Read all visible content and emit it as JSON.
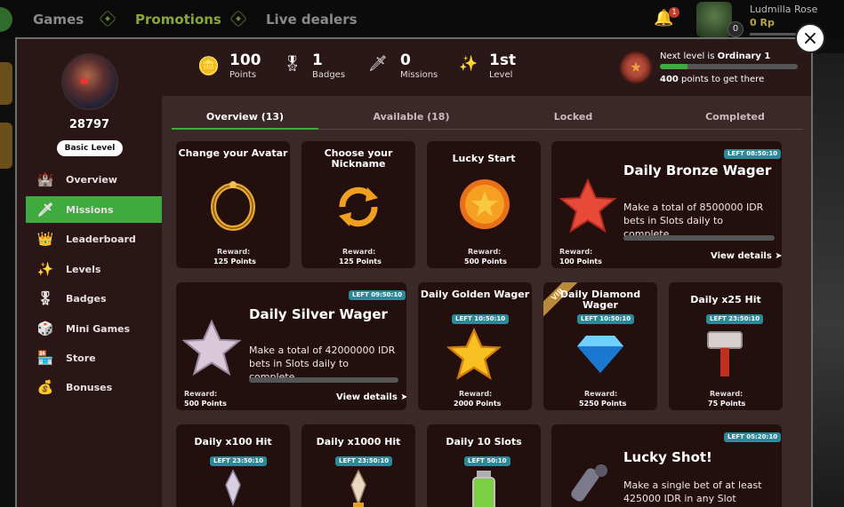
{
  "nav": {
    "games": "Games",
    "promotions": "Promotions",
    "live_dealers": "Live dealers",
    "bell_count": "1",
    "user_name": "Ludmilla Rose",
    "user_balance": "0 Rp",
    "avatar_level": "0"
  },
  "close_label": "×",
  "sidebar": {
    "user_id": "28797",
    "level_badge": "Basic Level",
    "items": [
      {
        "label": "Overview",
        "icon": "castle-icon"
      },
      {
        "label": "Missions",
        "icon": "sword-icon"
      },
      {
        "label": "Leaderboard",
        "icon": "crown-icon"
      },
      {
        "label": "Levels",
        "icon": "sparkles-icon"
      },
      {
        "label": "Badges",
        "icon": "medal-icon"
      },
      {
        "label": "Mini Games",
        "icon": "dice-icon"
      },
      {
        "label": "Store",
        "icon": "shop-icon"
      },
      {
        "label": "Bonuses",
        "icon": "money-bag-icon"
      }
    ]
  },
  "stats": {
    "points_value": "100",
    "points_label": "Points",
    "badges_value": "1",
    "badges_label": "Badges",
    "missions_value": "0",
    "missions_label": "Missions",
    "level_value": "1st",
    "level_label": "Level"
  },
  "next_level": {
    "prefix": "Next level is ",
    "name": "Ordinary 1",
    "progress": 0.2,
    "points": "400",
    "suffix": " points to get there"
  },
  "tabs": [
    "Overview (13)",
    "Available (18)",
    "Locked",
    "Completed"
  ],
  "reward_label": "Reward:",
  "view_details": "View details",
  "cards": {
    "avatar": {
      "title": "Change your Avatar",
      "reward": "125 Points"
    },
    "nickname": {
      "title": "Choose your Nickname",
      "reward": "125 Points"
    },
    "lucky_start": {
      "title": "Lucky Start",
      "reward": "500 Points"
    },
    "bronze": {
      "title": "Daily Bronze Wager",
      "timer": "LEFT 08:50:10",
      "desc": "Make a total of 8500000 IDR bets in Slots daily to complete…",
      "reward": "100 Points"
    },
    "silver": {
      "title": "Daily Silver Wager",
      "timer": "LEFT 09:50:10",
      "desc": "Make a total of 42000000 IDR bets in Slots daily to complete…",
      "reward": "500 Points"
    },
    "golden": {
      "title": "Daily Golden Wager",
      "timer": "LEFT 10:50:10",
      "reward": "2000 Points"
    },
    "diamond": {
      "title": "Daily Diamond Wager",
      "timer": "LEFT 10:50:10",
      "vip": "VIP",
      "reward": "5250 Points"
    },
    "x25": {
      "title": "Daily x25 Hit",
      "timer": "LEFT 23:50:10",
      "reward": "75 Points"
    },
    "x100": {
      "title": "Daily x100 Hit",
      "timer": "LEFT 23:50:10"
    },
    "x1000": {
      "title": "Daily x1000 Hit",
      "timer": "LEFT 23:50:10"
    },
    "slots10": {
      "title": "Daily 10 Slots",
      "timer": "LEFT 50:10"
    },
    "lucky_shot": {
      "title": "Lucky Shot!",
      "timer": "LEFT 05:20:10",
      "desc": "Make a single bet of at least 425000 IDR in any Slot"
    }
  },
  "colors": {
    "accent": "#3faa3f",
    "timer": "#2a8a9a",
    "card_bg": "#240f0f"
  }
}
